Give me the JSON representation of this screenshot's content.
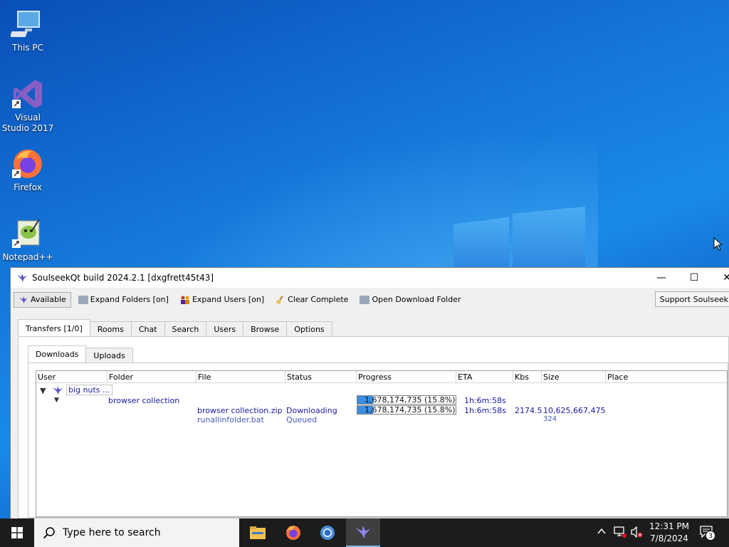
{
  "desktop": {
    "icons": [
      {
        "label": "This PC"
      },
      {
        "label": "Visual Studio 2017"
      },
      {
        "label": "Firefox"
      },
      {
        "label": "Notepad++"
      }
    ]
  },
  "window": {
    "title": "SoulseekQt build 2024.2.1 [dxgfrett45t43]",
    "controls": {
      "minimize": "—",
      "maximize": "☐",
      "close": "✕"
    }
  },
  "toolbar": {
    "status_label": "Available",
    "expand_folders": "Expand Folders [on]",
    "expand_users": "Expand Users [on]",
    "clear_complete": "Clear Complete",
    "open_download_folder": "Open Download Folder",
    "support": "Support Soulseek"
  },
  "main_tabs": [
    "Transfers [1/0]",
    "Rooms",
    "Chat",
    "Search",
    "Users",
    "Browse",
    "Options"
  ],
  "sub_tabs": [
    "Downloads",
    "Uploads"
  ],
  "columns": [
    "User",
    "Folder",
    "File",
    "Status",
    "Progress",
    "ETA",
    "Kbs",
    "Size",
    "Place"
  ],
  "transfers": {
    "user": "big nuts ...",
    "folder": "browser collection",
    "folder_progress": {
      "text": "1,678,174,735 (15.8%)",
      "fraction": 0.158
    },
    "folder_eta": "1h:6m:58s",
    "files": [
      {
        "file": "browser collection.zip",
        "status": "Downloading",
        "progress_text": "1,678,174,735 (15.8%)",
        "progress_fraction": 0.158,
        "eta": "1h:6m:58s",
        "kbs": "2174.5",
        "size": "10,625,667,475"
      },
      {
        "file": "runallinfolder.bat",
        "status": "Queued",
        "size": "324"
      }
    ]
  },
  "taskbar": {
    "search_placeholder": "Type here to search",
    "time": "12:31 PM",
    "date": "7/8/2024",
    "notification_count": "3"
  }
}
